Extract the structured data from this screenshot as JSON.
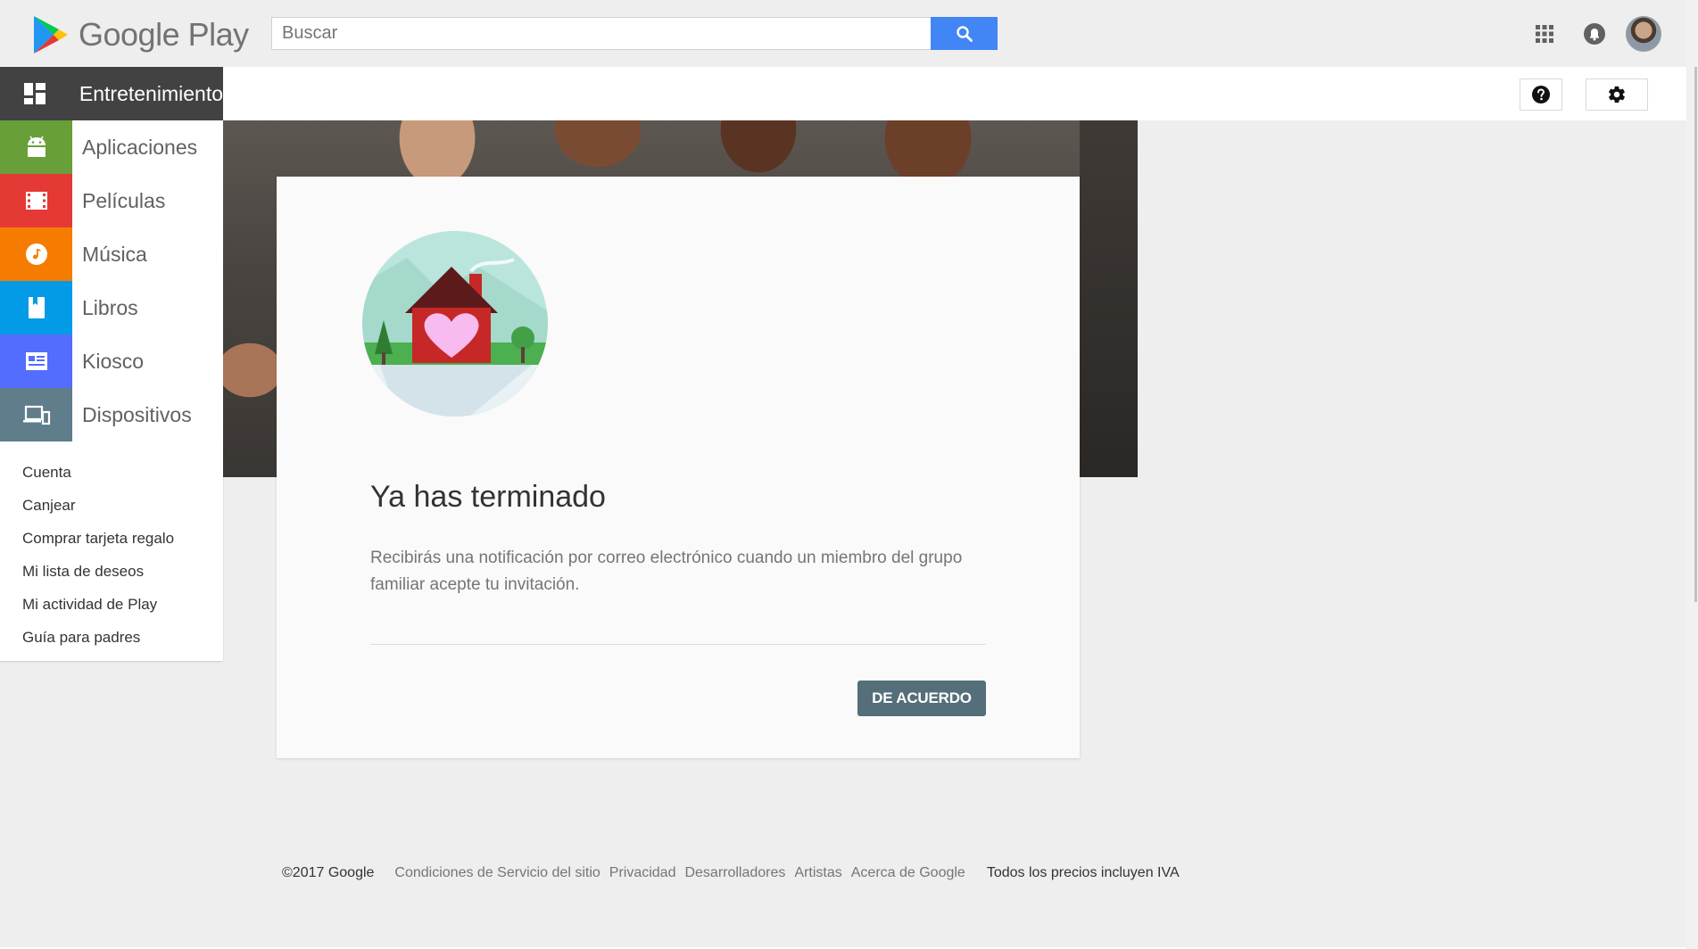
{
  "header": {
    "logo_text": "Google Play",
    "search_placeholder": "Buscar"
  },
  "sidebar": {
    "items": [
      {
        "label": "Entretenimiento",
        "icon": "grid-icon",
        "color": "#424242"
      },
      {
        "label": "Aplicaciones",
        "icon": "android-icon",
        "color": "#689f38"
      },
      {
        "label": "Películas",
        "icon": "film-icon",
        "color": "#e53935"
      },
      {
        "label": "Música",
        "icon": "music-icon",
        "color": "#f57c00"
      },
      {
        "label": "Libros",
        "icon": "book-icon",
        "color": "#039be5"
      },
      {
        "label": "Kiosco",
        "icon": "newsstand-icon",
        "color": "#536dfe"
      },
      {
        "label": "Dispositivos",
        "icon": "devices-icon",
        "color": "#607d8b"
      }
    ],
    "links": [
      "Cuenta",
      "Canjear",
      "Comprar tarjeta regalo",
      "Mi lista de deseos",
      "Mi actividad de Play",
      "Guía para padres"
    ]
  },
  "dialog": {
    "title": "Ya has terminado",
    "body": "Recibirás una notificación por correo electrónico cuando un miembro del grupo familiar acepte tu invitación.",
    "ok_label": "DE ACUERDO"
  },
  "footer": {
    "copyright": "©2017 Google",
    "links": [
      "Condiciones de Servicio del sitio",
      "Privacidad",
      "Desarrolladores",
      "Artistas",
      "Acerca de Google"
    ],
    "vat_note": "Todos los precios incluyen IVA"
  },
  "colors": {
    "search_button": "#4285f4",
    "ok_button": "#546e7a"
  }
}
